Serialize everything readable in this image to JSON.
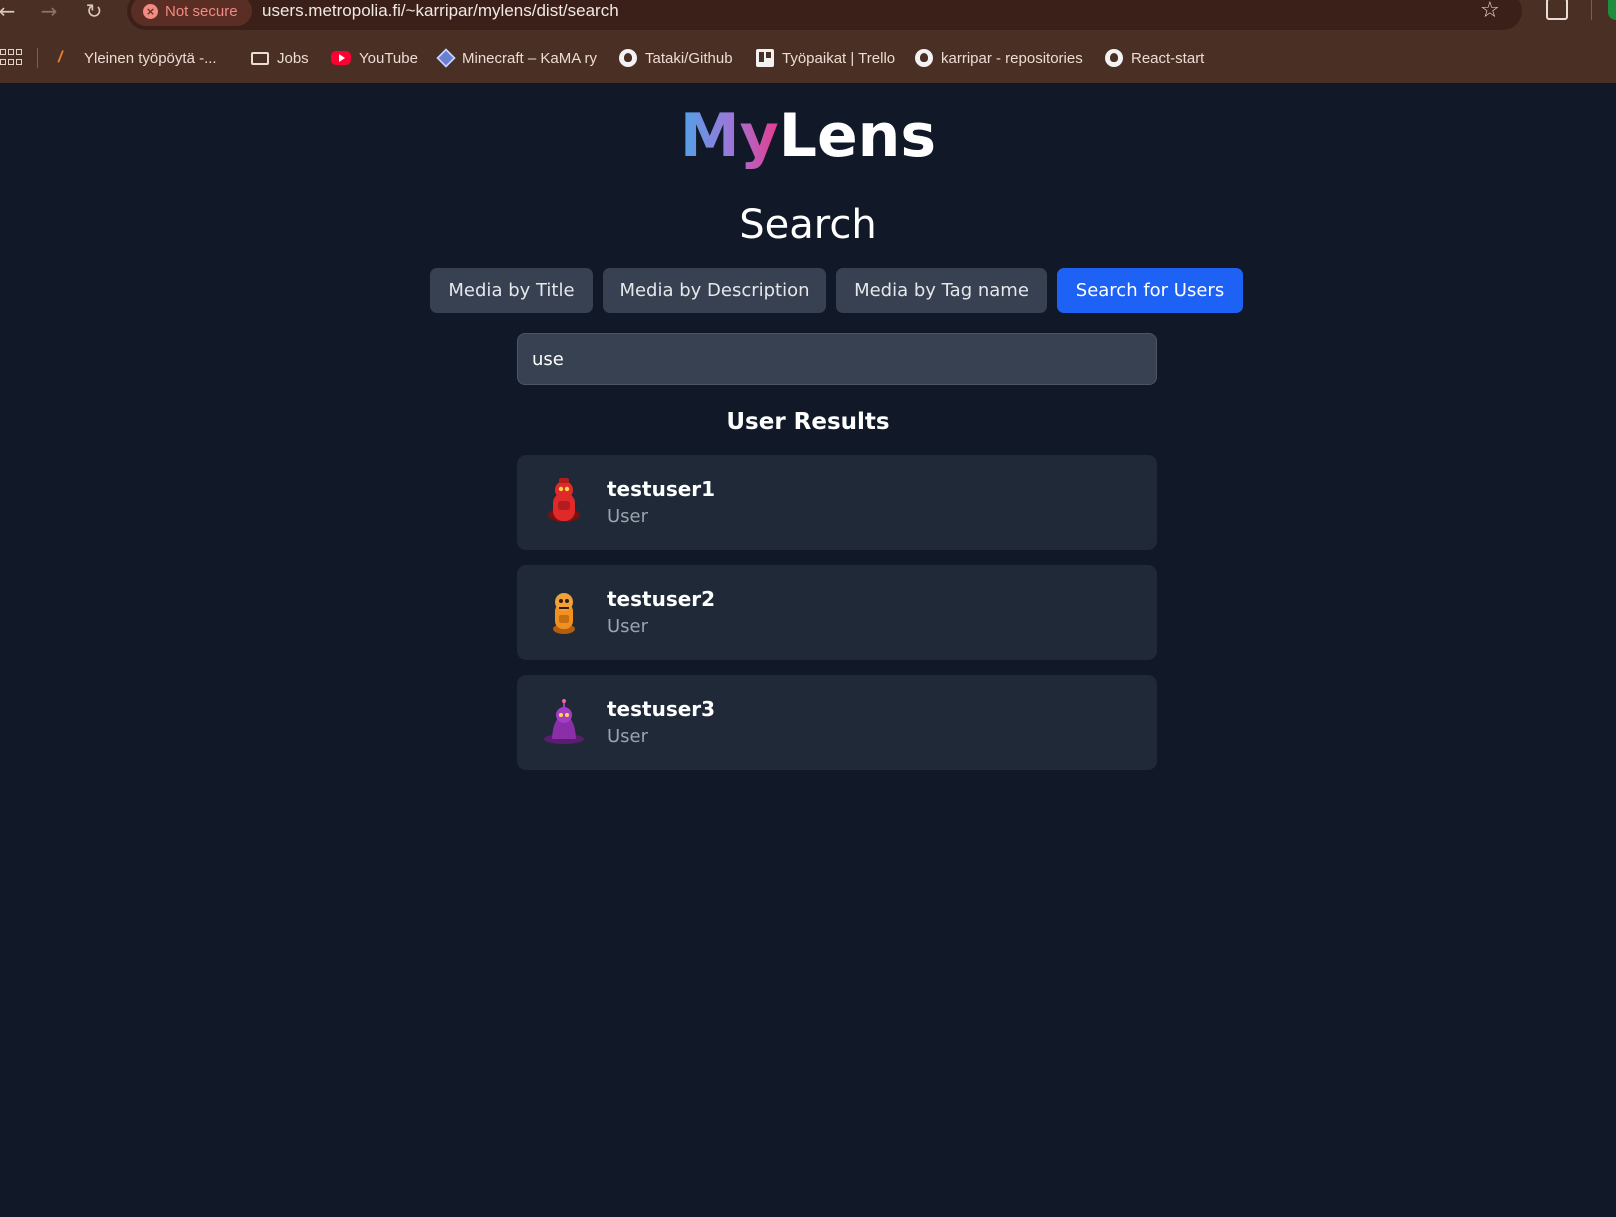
{
  "browser": {
    "security_label": "Not secure",
    "url": "users.metropolia.fi/~karripar/mylens/dist/search",
    "bookmarks": [
      {
        "label": "Yleinen työpöytä -...",
        "icon": "yleinen-icon"
      },
      {
        "label": "Jobs",
        "icon": "folder-icon"
      },
      {
        "label": "YouTube",
        "icon": "youtube-icon"
      },
      {
        "label": "Minecraft – KaMA ry",
        "icon": "minecraft-icon"
      },
      {
        "label": "Tataki/Github",
        "icon": "github-icon"
      },
      {
        "label": "Työpaikat | Trello",
        "icon": "trello-icon"
      },
      {
        "label": "karripar - repositories",
        "icon": "github-icon"
      },
      {
        "label": "React-start",
        "icon": "github-icon"
      }
    ]
  },
  "logo": {
    "part1": "My",
    "part2": "Lens"
  },
  "page": {
    "title": "Search"
  },
  "tabs": [
    {
      "label": "Media by Title",
      "active": false
    },
    {
      "label": "Media by Description",
      "active": false
    },
    {
      "label": "Media by Tag name",
      "active": false
    },
    {
      "label": "Search for Users",
      "active": true
    }
  ],
  "search": {
    "value": "use"
  },
  "results": {
    "heading": "User Results",
    "users": [
      {
        "username": "testuser1",
        "role": "User",
        "avatar_color": "#e02a2a"
      },
      {
        "username": "testuser2",
        "role": "User",
        "avatar_color": "#f0901e"
      },
      {
        "username": "testuser3",
        "role": "User",
        "avatar_color": "#8b2fa8"
      }
    ]
  },
  "colors": {
    "page_bg": "#111827",
    "card_bg": "#1f2937",
    "tab_bg": "#374151",
    "accent": "#1e62f5"
  }
}
